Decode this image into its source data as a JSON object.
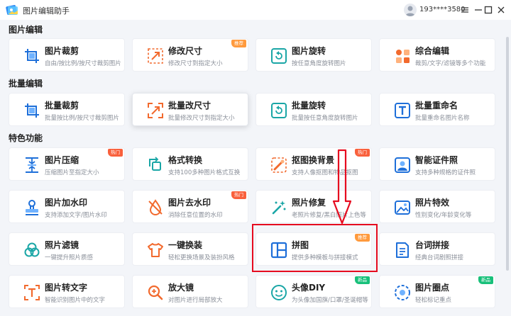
{
  "window": {
    "title": "图片编辑助手",
    "user": "193****3580",
    "logo_icon": "app-logo-icon",
    "avatar_icon": "user-avatar-icon"
  },
  "colors": {
    "icon_blue": "#1e6fd9",
    "icon_orange": "#f26a2e",
    "badge_orange": "#ff9a3d",
    "badge_red": "#f9603c",
    "badge_green": "#18c07a",
    "highlight_red": "#e60b1f"
  },
  "sections": [
    {
      "title": "图片编辑",
      "cards": [
        {
          "title": "图片裁剪",
          "desc": "自由/按比例/按尺寸裁剪图片",
          "icon": "crop-icon"
        },
        {
          "title": "修改尺寸",
          "desc": "修改尺寸到指定大小",
          "icon": "resize-icon",
          "badge": "推荐"
        },
        {
          "title": "图片旋转",
          "desc": "按任意角度旋转图片",
          "icon": "rotate-icon"
        },
        {
          "title": "综合编辑",
          "desc": "裁剪/文字/滤镜等多个功能",
          "icon": "apps-icon"
        }
      ]
    },
    {
      "title": "批量编辑",
      "cards": [
        {
          "title": "批量裁剪",
          "desc": "批量按比例/按尺寸裁剪图片",
          "icon": "batch-crop-icon"
        },
        {
          "title": "批量改尺寸",
          "desc": "批量修改尺寸到指定大小",
          "icon": "batch-resize-icon"
        },
        {
          "title": "批量旋转",
          "desc": "批量按任意角度旋转图片",
          "icon": "batch-rotate-icon"
        },
        {
          "title": "批量重命名",
          "desc": "批量重命名图片名称",
          "icon": "rename-icon"
        }
      ]
    },
    {
      "title": "特色功能",
      "cards": [
        {
          "title": "图片压缩",
          "desc": "压缩图片至指定大小",
          "icon": "compress-icon",
          "badge": "热门"
        },
        {
          "title": "格式转换",
          "desc": "支持100多种图片格式互换",
          "icon": "convert-icon"
        },
        {
          "title": "抠图换背景",
          "desc": "支持人像抠图和物品抠图",
          "icon": "cutout-icon",
          "badge": "热门"
        },
        {
          "title": "智能证件照",
          "desc": "支持多种规格的证件照",
          "icon": "id-photo-icon"
        },
        {
          "title": "图片加水印",
          "desc": "支持添加文字/图片水印",
          "icon": "stamp-icon"
        },
        {
          "title": "图片去水印",
          "desc": "消除任意位置的水印",
          "icon": "remove-watermark-icon",
          "badge": "热门"
        },
        {
          "title": "照片修复",
          "desc": "老照片修复/黑白照片上色等",
          "icon": "magic-wand-icon"
        },
        {
          "title": "照片特效",
          "desc": "性别变化/年龄变化等",
          "icon": "effect-icon"
        },
        {
          "title": "照片滤镜",
          "desc": "一键提升照片质感",
          "icon": "filter-icon"
        },
        {
          "title": "一键换装",
          "desc": "轻松更换场景及装扮风格",
          "icon": "shirt-icon"
        },
        {
          "title": "拼图",
          "desc": "提供多种模板与拼接模式",
          "icon": "collage-icon",
          "badge": "推荐"
        },
        {
          "title": "台词拼接",
          "desc": "经典台词剧照拼接",
          "icon": "quote-icon"
        },
        {
          "title": "图片转文字",
          "desc": "智能识别图片中的文字",
          "icon": "ocr-icon"
        },
        {
          "title": "放大镜",
          "desc": "对图片进行局部放大",
          "icon": "magnifier-icon"
        },
        {
          "title": "头像DIY",
          "desc": "为头像加国旗/口罩/圣诞帽等",
          "icon": "face-icon",
          "badge": "新品"
        },
        {
          "title": "图片圈点",
          "desc": "轻松标记重点",
          "icon": "circle-mark-icon",
          "badge": "新品"
        }
      ]
    }
  ]
}
